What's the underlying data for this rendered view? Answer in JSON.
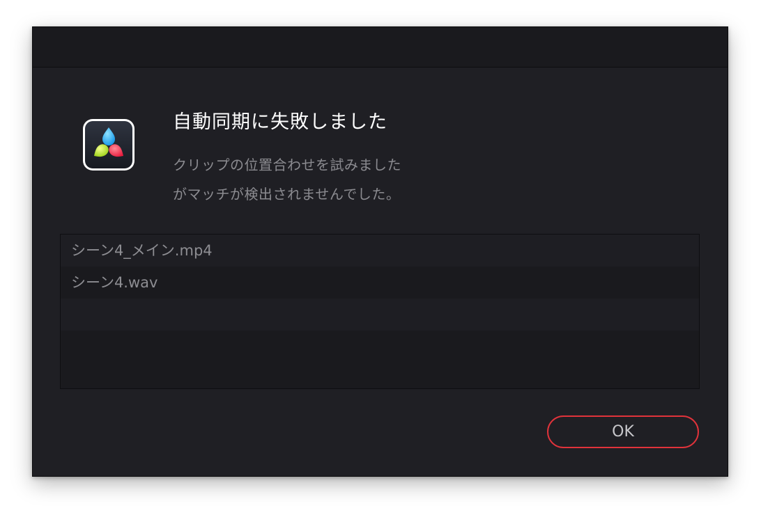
{
  "dialog": {
    "title": "自動同期に失敗しました",
    "message_line1": "クリップの位置合わせを試みました",
    "message_line2": "がマッチが検出されませんでした。",
    "app_icon": "davinci-resolve-icon",
    "files": [
      {
        "name": "シーン4_メイン.mp4"
      },
      {
        "name": "シーン4.wav"
      }
    ],
    "ok_label": "OK"
  },
  "colors": {
    "dialog_background": "#1f1f24",
    "accent_button_border": "#e1333b",
    "heading_text": "#ffffff",
    "secondary_text": "#8b8b90"
  }
}
